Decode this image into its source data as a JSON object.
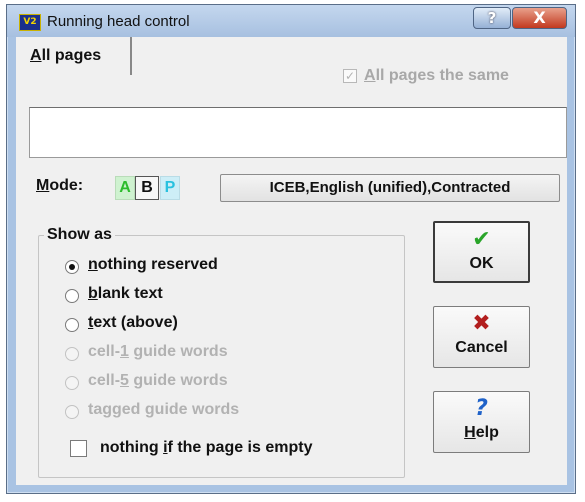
{
  "window": {
    "title": "Running head control",
    "app_icon_text": "V2",
    "help_glyph": "?",
    "close_glyph": "X"
  },
  "tab": {
    "prefix": "A",
    "rest": "ll pages"
  },
  "all_same": {
    "checked": true,
    "check_glyph": "✓",
    "prefix": "A",
    "rest": "ll pages the same"
  },
  "running_head_input": {
    "value": ""
  },
  "mode": {
    "label_prefix": "M",
    "label_rest": "ode:",
    "buttons": [
      "A",
      "B",
      "P"
    ],
    "selected": "B"
  },
  "translation_table": {
    "label": "ICEB,English (unified),Contracted"
  },
  "show_as": {
    "label": "Show as",
    "options": [
      {
        "prefix": "n",
        "rest": "othing reserved",
        "selected": true,
        "enabled": true
      },
      {
        "prefix": "b",
        "rest": "lank text",
        "selected": false,
        "enabled": true
      },
      {
        "prefix": "t",
        "rest": "ext (above)",
        "selected": false,
        "enabled": true
      },
      {
        "before": "cell-",
        "prefix": "1",
        "rest": " guide words",
        "selected": false,
        "enabled": false
      },
      {
        "before": "cell-",
        "prefix": "5",
        "rest": " guide words",
        "selected": false,
        "enabled": false
      },
      {
        "before": "tagged ",
        "prefix": "g",
        "rest": "uide words",
        "selected": false,
        "enabled": false
      }
    ]
  },
  "empty_page": {
    "checked": false,
    "before": "nothing ",
    "prefix": "i",
    "rest": "f the page is empty"
  },
  "buttons": {
    "ok": {
      "label": "OK",
      "icon": "checkmark-icon",
      "glyph": "✔"
    },
    "cancel": {
      "label": "Cancel",
      "icon": "x-icon",
      "glyph": "✖"
    },
    "help": {
      "prefix": "H",
      "rest": "elp",
      "icon": "question-icon",
      "glyph": "?"
    }
  }
}
